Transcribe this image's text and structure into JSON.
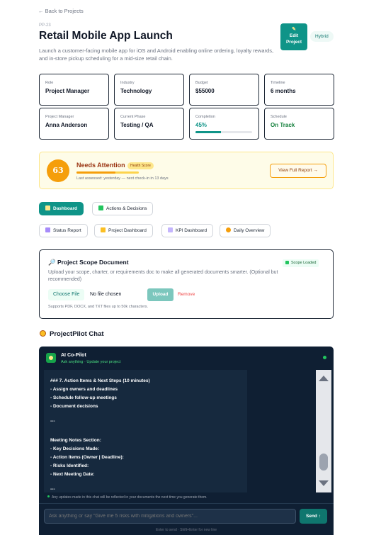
{
  "header": {
    "back_label": "← Back to Projects",
    "project_id": "PP-23",
    "title": "Retail Mobile App Launch",
    "description": "Launch a customer-facing mobile app for iOS and Android enabling online ordering, loyalty rewards, and in-store pickup scheduling for a mid-size retail chain.",
    "edit_label_line1": "Edit",
    "edit_label_line2": "Project",
    "mode_badge": "Hybrid"
  },
  "info_cards": [
    {
      "label": "Role",
      "value": "Project Manager"
    },
    {
      "label": "Industry",
      "value": "Technology"
    },
    {
      "label": "Budget",
      "value": "$55000"
    },
    {
      "label": "Timeline",
      "value": "6 months"
    },
    {
      "label": "Project Manager",
      "value": "Anna Anderson"
    },
    {
      "label": "Current Phase",
      "value": "Testing / QA"
    },
    {
      "label": "Completion",
      "value": "45%",
      "progress": 0.45
    },
    {
      "label": "Schedule",
      "value": "On Track"
    }
  ],
  "health": {
    "score": "63",
    "status": "Needs Attention",
    "badge": "Health Score",
    "score_fraction": 0.63,
    "assessed": "Last assessed: yesterday — next check-in in 13 days",
    "full_report_label": "View Full Report →"
  },
  "tabs": [
    {
      "label": "Dashboard",
      "icon": "chart-icon",
      "active": true
    },
    {
      "label": "Actions & Decisions",
      "icon": "checklist-icon",
      "active": false
    }
  ],
  "subtabs": [
    {
      "label": "Status Report",
      "icon": "bar-chart-icon"
    },
    {
      "label": "Project Dashboard",
      "icon": "folder-icon"
    },
    {
      "label": "KPI Dashboard",
      "icon": "graph-icon"
    },
    {
      "label": "Daily Overview",
      "icon": "sun-icon"
    }
  ],
  "scope": {
    "title": "🔎 Project Scope Document",
    "loaded_badge": "Scope Loaded",
    "description": "Upload your scope, charter, or requirements doc to make all generated documents smarter. (Optional but recommended)",
    "choose_file": "Choose File",
    "no_file": "No file chosen",
    "upload": "Upload",
    "remove": "Remove",
    "supports": "Supports PDF, DOCX, and TXT files up to 50k characters."
  },
  "chat": {
    "section_title": "ProjectPilot Chat",
    "bot_name": "AI Co-Pilot",
    "bot_subtitle": "Ask anything · Update your project",
    "messages": [
      "### 7. Action Items & Next Steps (10 minutes)",
      "- Assign owners and deadlines",
      "- Schedule follow-up meetings",
      "- Document decisions",
      "",
      "---",
      "",
      "Meeting Notes Section:",
      "- Key Decisions Made:",
      "- Action Items (Owner | Deadline):",
      "- Risks Identified:",
      "- Next Meeting Date:",
      "",
      "---"
    ],
    "note": "Any updates made in this chat will be reflected in your documents the next time you generate them.",
    "input_placeholder": "Ask anything or say \"Give me 5 risks with mitigations and owners\"...",
    "send_label": "Send ↑",
    "enter_hint": "Enter to send · Shift+Enter for new line"
  },
  "colors": {
    "accent": "#0f9488",
    "warning": "#f59e0b",
    "chat_bg": "#0f1f33",
    "success": "#15803d"
  }
}
